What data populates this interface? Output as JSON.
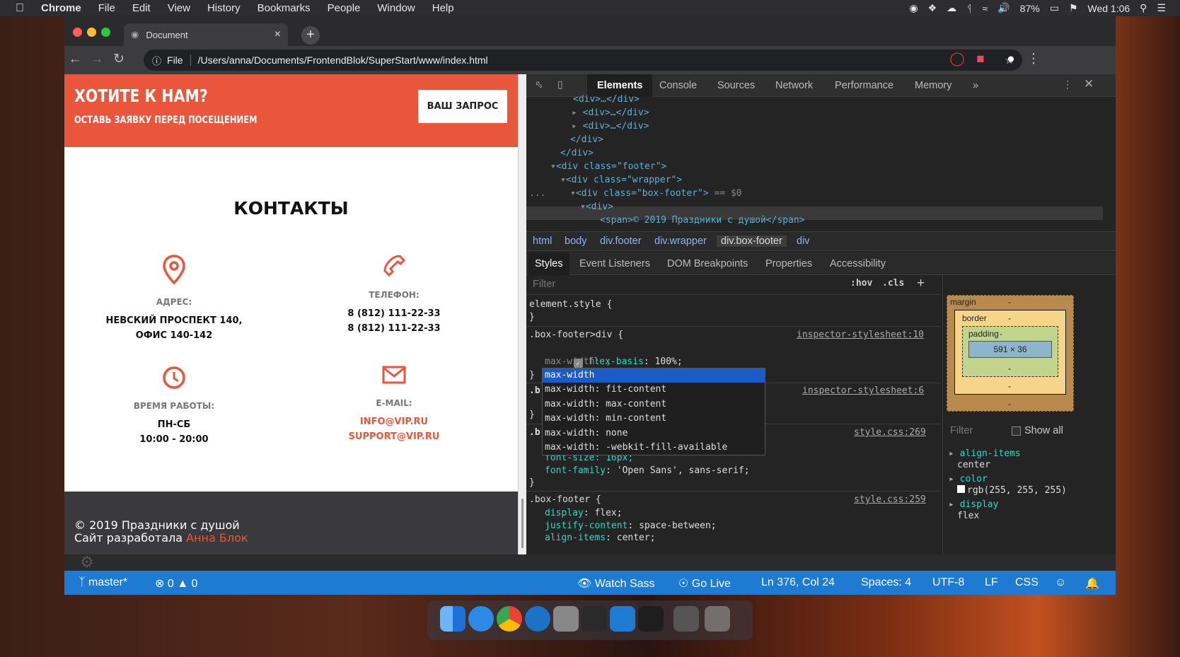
{
  "menubar": {
    "apple_icon": "apple-icon",
    "items": [
      "Chrome",
      "File",
      "Edit",
      "View",
      "History",
      "Bookmarks",
      "People",
      "Window",
      "Help"
    ],
    "battery": "87%",
    "clock": "Wed 1:06"
  },
  "browser": {
    "tab_title": "Document",
    "tab_close": "×",
    "new_tab": "+",
    "file_label": "File",
    "url": "/Users/anna/Documents/FrontendBlok/SuperStart/www/index.html"
  },
  "page": {
    "promo_title": "ХОТИТЕ К НАМ?",
    "promo_subtitle": "ОСТАВЬ ЗАЯВКУ ПЕРЕД ПОСЕЩЕНИЕМ",
    "request_button": "ВАШ ЗАПРОС",
    "contacts_title": "КОНТАКТЫ",
    "address_label": "АДРЕС:",
    "address_line1": "НЕВСКИЙ ПРОСПЕКТ 140,",
    "address_line2": "ОФИС 140-142",
    "phone_label": "ТЕЛЕФОН:",
    "phone1": "8 (812) 111-22-33",
    "phone2": "8 (812) 111-22-33",
    "hours_label": "ВРЕМЯ РАБОТЫ:",
    "hours_days": "ПН-СБ",
    "hours_time": "10:00 - 20:00",
    "email_label": "E-MAIL:",
    "email1": "INFO@VIP.RU",
    "email2": "SUPPORT@VIP.RU",
    "footer_copy": "© 2019 Праздники с душой",
    "footer_dev": "Сайт разработала",
    "footer_author": "Анна Блок"
  },
  "devtools": {
    "tabs": [
      "Elements",
      "Console",
      "Sources",
      "Network",
      "Performance",
      "Memory"
    ],
    "more": "»",
    "dom": {
      "l0": "<div>…</div>",
      "l1": "<div>…</div>",
      "l2": "<div>…</div>",
      "l3": "</div>",
      "l4": "</div>",
      "footer_tag": "<div class=\"footer\">",
      "wrapper_tag": "<div class=\"wrapper\">",
      "boxfooter_tag": "<div class=\"box-footer\">",
      "boxfooter_suffix": "== $0",
      "div_tag": "<div>",
      "span_line": "<span>© 2019 Праздники с душой</span>",
      "dots": "..."
    },
    "breadcrumbs": [
      "html",
      "body",
      "div.footer",
      "div.wrapper",
      "div.box-footer",
      "div"
    ],
    "style_tabs": [
      "Styles",
      "Event Listeners",
      "DOM Breakpoints",
      "Properties",
      "Accessibility"
    ],
    "filter_placeholder": "Filter",
    "hov": ":hov",
    "cls": ".cls",
    "plus": "+",
    "styles": {
      "element_style": "element.style {",
      "close": "}",
      "rule1_selector": ".box-footer>div {",
      "rule1_src": "inspector-stylesheet:10",
      "rule1_prop1": "flex-basis",
      "rule1_val1": "100%;",
      "rule1_typing": "max-width: ;",
      "rule2_selector": ".b",
      "rule2_src": "inspector-stylesheet:6",
      "rule3_selector": ".b",
      "rule3_src": "style.css:269",
      "rule3_fontsize": "font-size: 16px;",
      "rule3_fontfamily_prop": "font-family",
      "rule3_fontfamily_val": "'Open Sans', sans-serif;",
      "rule4_selector": ".box-footer {",
      "rule4_src": "style.css:259",
      "rule4_p1": "display",
      "rule4_v1": "flex;",
      "rule4_p2": "justify-content",
      "rule4_v2": "space-between;",
      "rule4_p3": "align-items",
      "rule4_v3": "center;"
    },
    "autocomplete": [
      "max-width",
      "max-width: fit-content",
      "max-width: max-content",
      "max-width: min-content",
      "max-width: none",
      "max-width: -webkit-fill-available"
    ],
    "boxmodel": {
      "margin_label": "margin",
      "border_label": "border",
      "padding_label": "padding",
      "dash": "-",
      "content": "591 × 36"
    },
    "computed": {
      "filter": "Filter",
      "show_all": "Show all",
      "p1": "align-items",
      "v1": "center",
      "p2": "color",
      "v2": "rgb(255, 255, 255)",
      "p3": "display",
      "v3": "flex"
    }
  },
  "vscode_status": {
    "branch": "master*",
    "errors": "0",
    "warnings": "0",
    "watch_sass": "Watch Sass",
    "go_live": "Go Live",
    "position": "Ln 376, Col 24",
    "spaces": "Spaces: 4",
    "encoding": "UTF-8",
    "eol": "LF",
    "language": "CSS"
  },
  "colors": {
    "accent": "#e9563b",
    "statusbar": "#1f7ad1",
    "footer_bg": "#3a393d"
  }
}
